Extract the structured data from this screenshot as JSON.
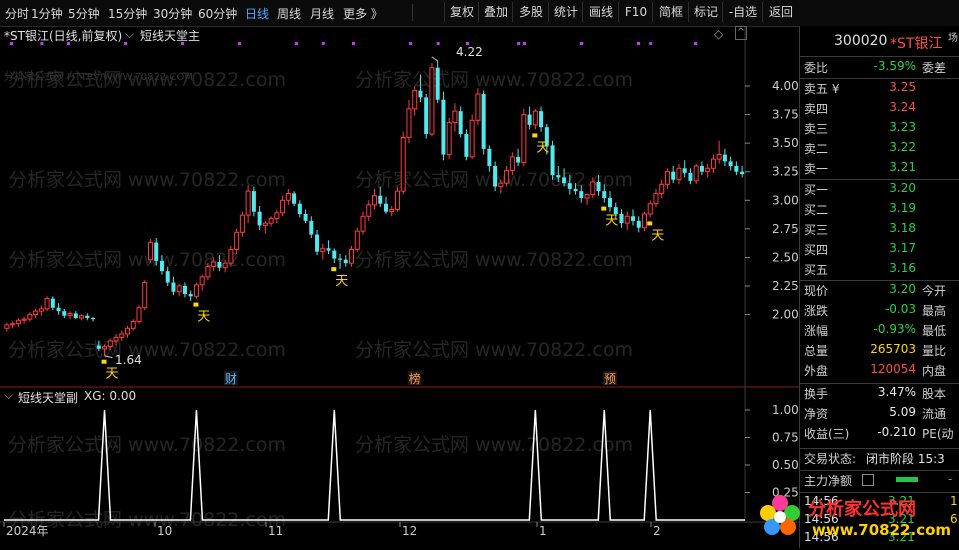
{
  "toolbar": {
    "periods": [
      "分时",
      "1分钟",
      "5分钟",
      "15分钟",
      "30分钟",
      "60分钟",
      "日线",
      "周线",
      "月线",
      "更多 》"
    ],
    "active_period": "日线",
    "buttons": [
      "复权",
      "叠加",
      "多股",
      "统计",
      "画线",
      "F10",
      "简框",
      "标记",
      "-自选",
      "返回"
    ]
  },
  "chart_header": {
    "stock_title": "*ST银江(日线,前复权)",
    "indicator_main": "短线天堂主",
    "watermark_url_small": "分析家公式网 HTTP://WWW.70822.COM"
  },
  "watermark_text": "分析家公式网 www.70822.com",
  "sub_header": {
    "indicator_sub": "短线天堂副",
    "xg_label": "XG: 0.00"
  },
  "price_axis": [
    "4.00",
    "3.75",
    "3.50",
    "3.25",
    "3.00",
    "2.75",
    "2.50",
    "2.25",
    "2.00"
  ],
  "sub_axis": [
    "1.00",
    "0.75",
    "0.50",
    "0.25"
  ],
  "date_axis": [
    "2024年",
    "10",
    "11",
    "12",
    "1",
    "2"
  ],
  "annotations": {
    "high_label": "4.22",
    "low_label": "1.64",
    "signal_char": "天",
    "events": [
      "财",
      "榜",
      "预"
    ]
  },
  "colors": {
    "up": "#ff3b3b",
    "down": "#52e8ee",
    "signal": "#ffd800",
    "marker": "#cc33ff"
  },
  "chart_data": {
    "type": "candlestick",
    "title": "*ST银江(日线,前复权)",
    "y_range": [
      1.55,
      4.35
    ],
    "date_ticks": [
      "2024年",
      "10",
      "11",
      "12",
      "1",
      "2"
    ],
    "high": 4.22,
    "low": 1.64,
    "ohlc": [
      [
        1.88,
        1.93,
        1.85,
        1.91
      ],
      [
        1.91,
        1.94,
        1.88,
        1.92
      ],
      [
        1.92,
        1.97,
        1.89,
        1.95
      ],
      [
        1.95,
        1.98,
        1.92,
        1.96
      ],
      [
        1.96,
        2.02,
        1.94,
        2.0
      ],
      [
        2.0,
        2.05,
        1.97,
        2.03
      ],
      [
        2.03,
        2.08,
        1.99,
        2.05
      ],
      [
        2.05,
        2.16,
        2.03,
        2.14
      ],
      [
        2.14,
        2.16,
        2.04,
        2.06
      ],
      [
        2.06,
        2.1,
        2.0,
        2.03
      ],
      [
        2.03,
        2.05,
        1.97,
        1.99
      ],
      [
        1.99,
        2.03,
        1.96,
        2.01
      ],
      [
        2.01,
        2.03,
        1.96,
        1.97
      ],
      [
        1.97,
        2.0,
        1.95,
        1.99
      ],
      [
        1.99,
        2.01,
        1.95,
        1.97
      ],
      [
        1.97,
        1.98,
        1.94,
        1.96
      ],
      [
        1.73,
        1.77,
        1.68,
        1.7
      ],
      [
        1.7,
        1.74,
        1.64,
        1.72
      ],
      [
        1.72,
        1.79,
        1.69,
        1.77
      ],
      [
        1.77,
        1.83,
        1.73,
        1.8
      ],
      [
        1.8,
        1.86,
        1.77,
        1.83
      ],
      [
        1.83,
        1.9,
        1.8,
        1.88
      ],
      [
        1.88,
        1.96,
        1.86,
        1.94
      ],
      [
        1.94,
        2.08,
        1.92,
        2.06
      ],
      [
        2.06,
        2.3,
        2.04,
        2.28
      ],
      [
        2.48,
        2.66,
        2.45,
        2.63
      ],
      [
        2.63,
        2.67,
        2.43,
        2.47
      ],
      [
        2.47,
        2.52,
        2.35,
        2.38
      ],
      [
        2.38,
        2.42,
        2.25,
        2.28
      ],
      [
        2.28,
        2.33,
        2.17,
        2.2
      ],
      [
        2.2,
        2.27,
        2.16,
        2.25
      ],
      [
        2.25,
        2.28,
        2.15,
        2.18
      ],
      [
        2.18,
        2.21,
        2.12,
        2.16
      ],
      [
        2.16,
        2.28,
        2.14,
        2.26
      ],
      [
        2.26,
        2.35,
        2.21,
        2.33
      ],
      [
        2.33,
        2.45,
        2.3,
        2.42
      ],
      [
        2.42,
        2.5,
        2.38,
        2.46
      ],
      [
        2.46,
        2.52,
        2.38,
        2.41
      ],
      [
        2.41,
        2.48,
        2.37,
        2.45
      ],
      [
        2.45,
        2.6,
        2.42,
        2.57
      ],
      [
        2.57,
        2.75,
        2.53,
        2.72
      ],
      [
        2.72,
        2.9,
        2.68,
        2.87
      ],
      [
        2.87,
        3.13,
        2.8,
        3.08
      ],
      [
        3.08,
        3.12,
        2.86,
        2.9
      ],
      [
        2.9,
        2.95,
        2.74,
        2.78
      ],
      [
        2.78,
        2.82,
        2.71,
        2.8
      ],
      [
        2.8,
        2.86,
        2.77,
        2.84
      ],
      [
        2.84,
        2.92,
        2.8,
        2.89
      ],
      [
        2.89,
        3.04,
        2.86,
        3.0
      ],
      [
        3.0,
        3.1,
        2.96,
        3.06
      ],
      [
        3.06,
        3.08,
        2.95,
        2.97
      ],
      [
        2.97,
        3.0,
        2.85,
        2.88
      ],
      [
        2.88,
        2.92,
        2.8,
        2.82
      ],
      [
        2.82,
        2.86,
        2.67,
        2.7
      ],
      [
        2.7,
        2.74,
        2.52,
        2.55
      ],
      [
        2.55,
        2.62,
        2.48,
        2.58
      ],
      [
        2.58,
        2.65,
        2.53,
        2.56
      ],
      [
        2.56,
        2.58,
        2.45,
        2.49
      ],
      [
        2.49,
        2.53,
        2.4,
        2.48
      ],
      [
        2.48,
        2.52,
        2.42,
        2.45
      ],
      [
        2.45,
        2.6,
        2.42,
        2.57
      ],
      [
        2.57,
        2.76,
        2.55,
        2.73
      ],
      [
        2.73,
        2.9,
        2.7,
        2.86
      ],
      [
        2.86,
        3.0,
        2.82,
        2.96
      ],
      [
        2.96,
        3.1,
        2.92,
        3.04
      ],
      [
        3.04,
        3.12,
        2.94,
        2.97
      ],
      [
        2.97,
        3.03,
        2.88,
        2.9
      ],
      [
        2.9,
        2.95,
        2.86,
        2.92
      ],
      [
        2.92,
        3.12,
        2.9,
        3.08
      ],
      [
        3.08,
        3.6,
        3.05,
        3.55
      ],
      [
        3.55,
        3.88,
        3.5,
        3.8
      ],
      [
        3.8,
        4.0,
        3.74,
        3.96
      ],
      [
        3.96,
        4.1,
        3.86,
        3.9
      ],
      [
        3.9,
        3.93,
        3.54,
        3.58
      ],
      [
        3.58,
        4.2,
        3.56,
        4.16
      ],
      [
        4.16,
        4.22,
        3.85,
        3.88
      ],
      [
        3.88,
        3.95,
        3.35,
        3.4
      ],
      [
        3.4,
        3.72,
        3.36,
        3.68
      ],
      [
        3.68,
        3.85,
        3.6,
        3.78
      ],
      [
        3.78,
        3.82,
        3.55,
        3.58
      ],
      [
        3.58,
        3.62,
        3.35,
        3.38
      ],
      [
        3.38,
        3.75,
        3.36,
        3.7
      ],
      [
        3.7,
        3.98,
        3.66,
        3.93
      ],
      [
        3.93,
        3.96,
        3.4,
        3.45
      ],
      [
        3.45,
        3.48,
        3.25,
        3.3
      ],
      [
        3.3,
        3.34,
        3.08,
        3.12
      ],
      [
        3.12,
        3.18,
        3.06,
        3.15
      ],
      [
        3.15,
        3.3,
        3.12,
        3.26
      ],
      [
        3.26,
        3.42,
        3.22,
        3.38
      ],
      [
        3.38,
        3.45,
        3.3,
        3.33
      ],
      [
        3.33,
        3.8,
        3.3,
        3.75
      ],
      [
        3.75,
        3.82,
        3.62,
        3.66
      ],
      [
        3.66,
        3.8,
        3.62,
        3.78
      ],
      [
        3.78,
        3.82,
        3.6,
        3.64
      ],
      [
        3.64,
        3.67,
        3.4,
        3.48
      ],
      [
        3.48,
        3.52,
        3.18,
        3.22
      ],
      [
        3.22,
        3.3,
        3.16,
        3.2
      ],
      [
        3.2,
        3.28,
        3.12,
        3.15
      ],
      [
        3.15,
        3.22,
        3.05,
        3.1
      ],
      [
        3.1,
        3.15,
        3.05,
        3.08
      ],
      [
        3.08,
        3.13,
        2.98,
        3.02
      ],
      [
        3.02,
        3.06,
        2.96,
        3.05
      ],
      [
        3.05,
        3.2,
        3.02,
        3.16
      ],
      [
        3.16,
        3.22,
        3.04,
        3.08
      ],
      [
        3.08,
        3.14,
        2.98,
        3.02
      ],
      [
        3.02,
        3.08,
        2.9,
        2.94
      ],
      [
        2.94,
        2.98,
        2.84,
        2.88
      ],
      [
        2.88,
        2.92,
        2.76,
        2.8
      ],
      [
        2.8,
        2.9,
        2.74,
        2.86
      ],
      [
        2.86,
        2.92,
        2.78,
        2.82
      ],
      [
        2.82,
        2.86,
        2.72,
        2.76
      ],
      [
        2.76,
        2.9,
        2.73,
        2.88
      ],
      [
        2.88,
        3.0,
        2.85,
        2.97
      ],
      [
        2.97,
        3.1,
        2.94,
        3.06
      ],
      [
        3.06,
        3.18,
        3.02,
        3.14
      ],
      [
        3.14,
        3.28,
        3.1,
        3.25
      ],
      [
        3.25,
        3.3,
        3.15,
        3.18
      ],
      [
        3.18,
        3.32,
        3.14,
        3.28
      ],
      [
        3.28,
        3.35,
        3.2,
        3.24
      ],
      [
        3.24,
        3.28,
        3.14,
        3.17
      ],
      [
        3.17,
        3.32,
        3.14,
        3.3
      ],
      [
        3.3,
        3.34,
        3.22,
        3.25
      ],
      [
        3.25,
        3.32,
        3.2,
        3.28
      ],
      [
        3.28,
        3.4,
        3.24,
        3.36
      ],
      [
        3.36,
        3.52,
        3.32,
        3.4
      ],
      [
        3.4,
        3.45,
        3.3,
        3.34
      ],
      [
        3.34,
        3.38,
        3.26,
        3.3
      ],
      [
        3.3,
        3.34,
        3.22,
        3.25
      ],
      [
        3.25,
        3.3,
        3.2,
        3.23
      ]
    ],
    "signals_idx": [
      17,
      33,
      57,
      92,
      104,
      112
    ],
    "xg_series_peaks_idx": [
      17,
      33,
      57,
      92,
      104,
      112
    ]
  },
  "right_panel": {
    "code": "300020",
    "name": "*ST银江",
    "corner": "场",
    "weibi_label": "委比",
    "weibi_val": "-3.59%",
    "weicha_label": "委差",
    "asks": [
      {
        "label": "卖五 ¥",
        "price": "3.25"
      },
      {
        "label": "卖四",
        "price": "3.24"
      },
      {
        "label": "卖三",
        "price": "3.23"
      },
      {
        "label": "卖二",
        "price": "3.22"
      },
      {
        "label": "卖一",
        "price": "3.21"
      }
    ],
    "bids": [
      {
        "label": "买一",
        "price": "3.20"
      },
      {
        "label": "买二",
        "price": "3.19"
      },
      {
        "label": "买三",
        "price": "3.18"
      },
      {
        "label": "买四",
        "price": "3.17"
      },
      {
        "label": "买五",
        "price": "3.16"
      }
    ],
    "stats": [
      {
        "label": "现价",
        "val": "3.20",
        "label2": "今开"
      },
      {
        "label": "涨跌",
        "val": "-0.03",
        "label2": "最高"
      },
      {
        "label": "涨幅",
        "val": "-0.93%",
        "label2": "最低"
      },
      {
        "label": "总量",
        "val": "265703",
        "label2": "量比"
      },
      {
        "label": "外盘",
        "val": "120054",
        "label2": "内盘"
      }
    ],
    "stats2": [
      {
        "label": "换手",
        "val": "3.47%",
        "label2": "股本"
      },
      {
        "label": "净资",
        "val": "5.09",
        "label2": "流通"
      },
      {
        "label": "收益(三)",
        "val": "-0.210",
        "label2": "PE(动"
      }
    ],
    "trade_status_label": "交易状态:",
    "trade_status_val": "闭市阶段 15:3",
    "main_net_label": "主力净额",
    "main_net_val": "-",
    "ticks": [
      {
        "time": "14:56",
        "price": "3.21",
        "vol": "1"
      },
      {
        "time": "14:56",
        "price": "3.21",
        "vol": "6"
      },
      {
        "time": "14:56",
        "price": "3.21",
        "vol": ""
      }
    ]
  },
  "logo": {
    "main": "分析家公式网",
    "sub": "www.70822.com"
  }
}
